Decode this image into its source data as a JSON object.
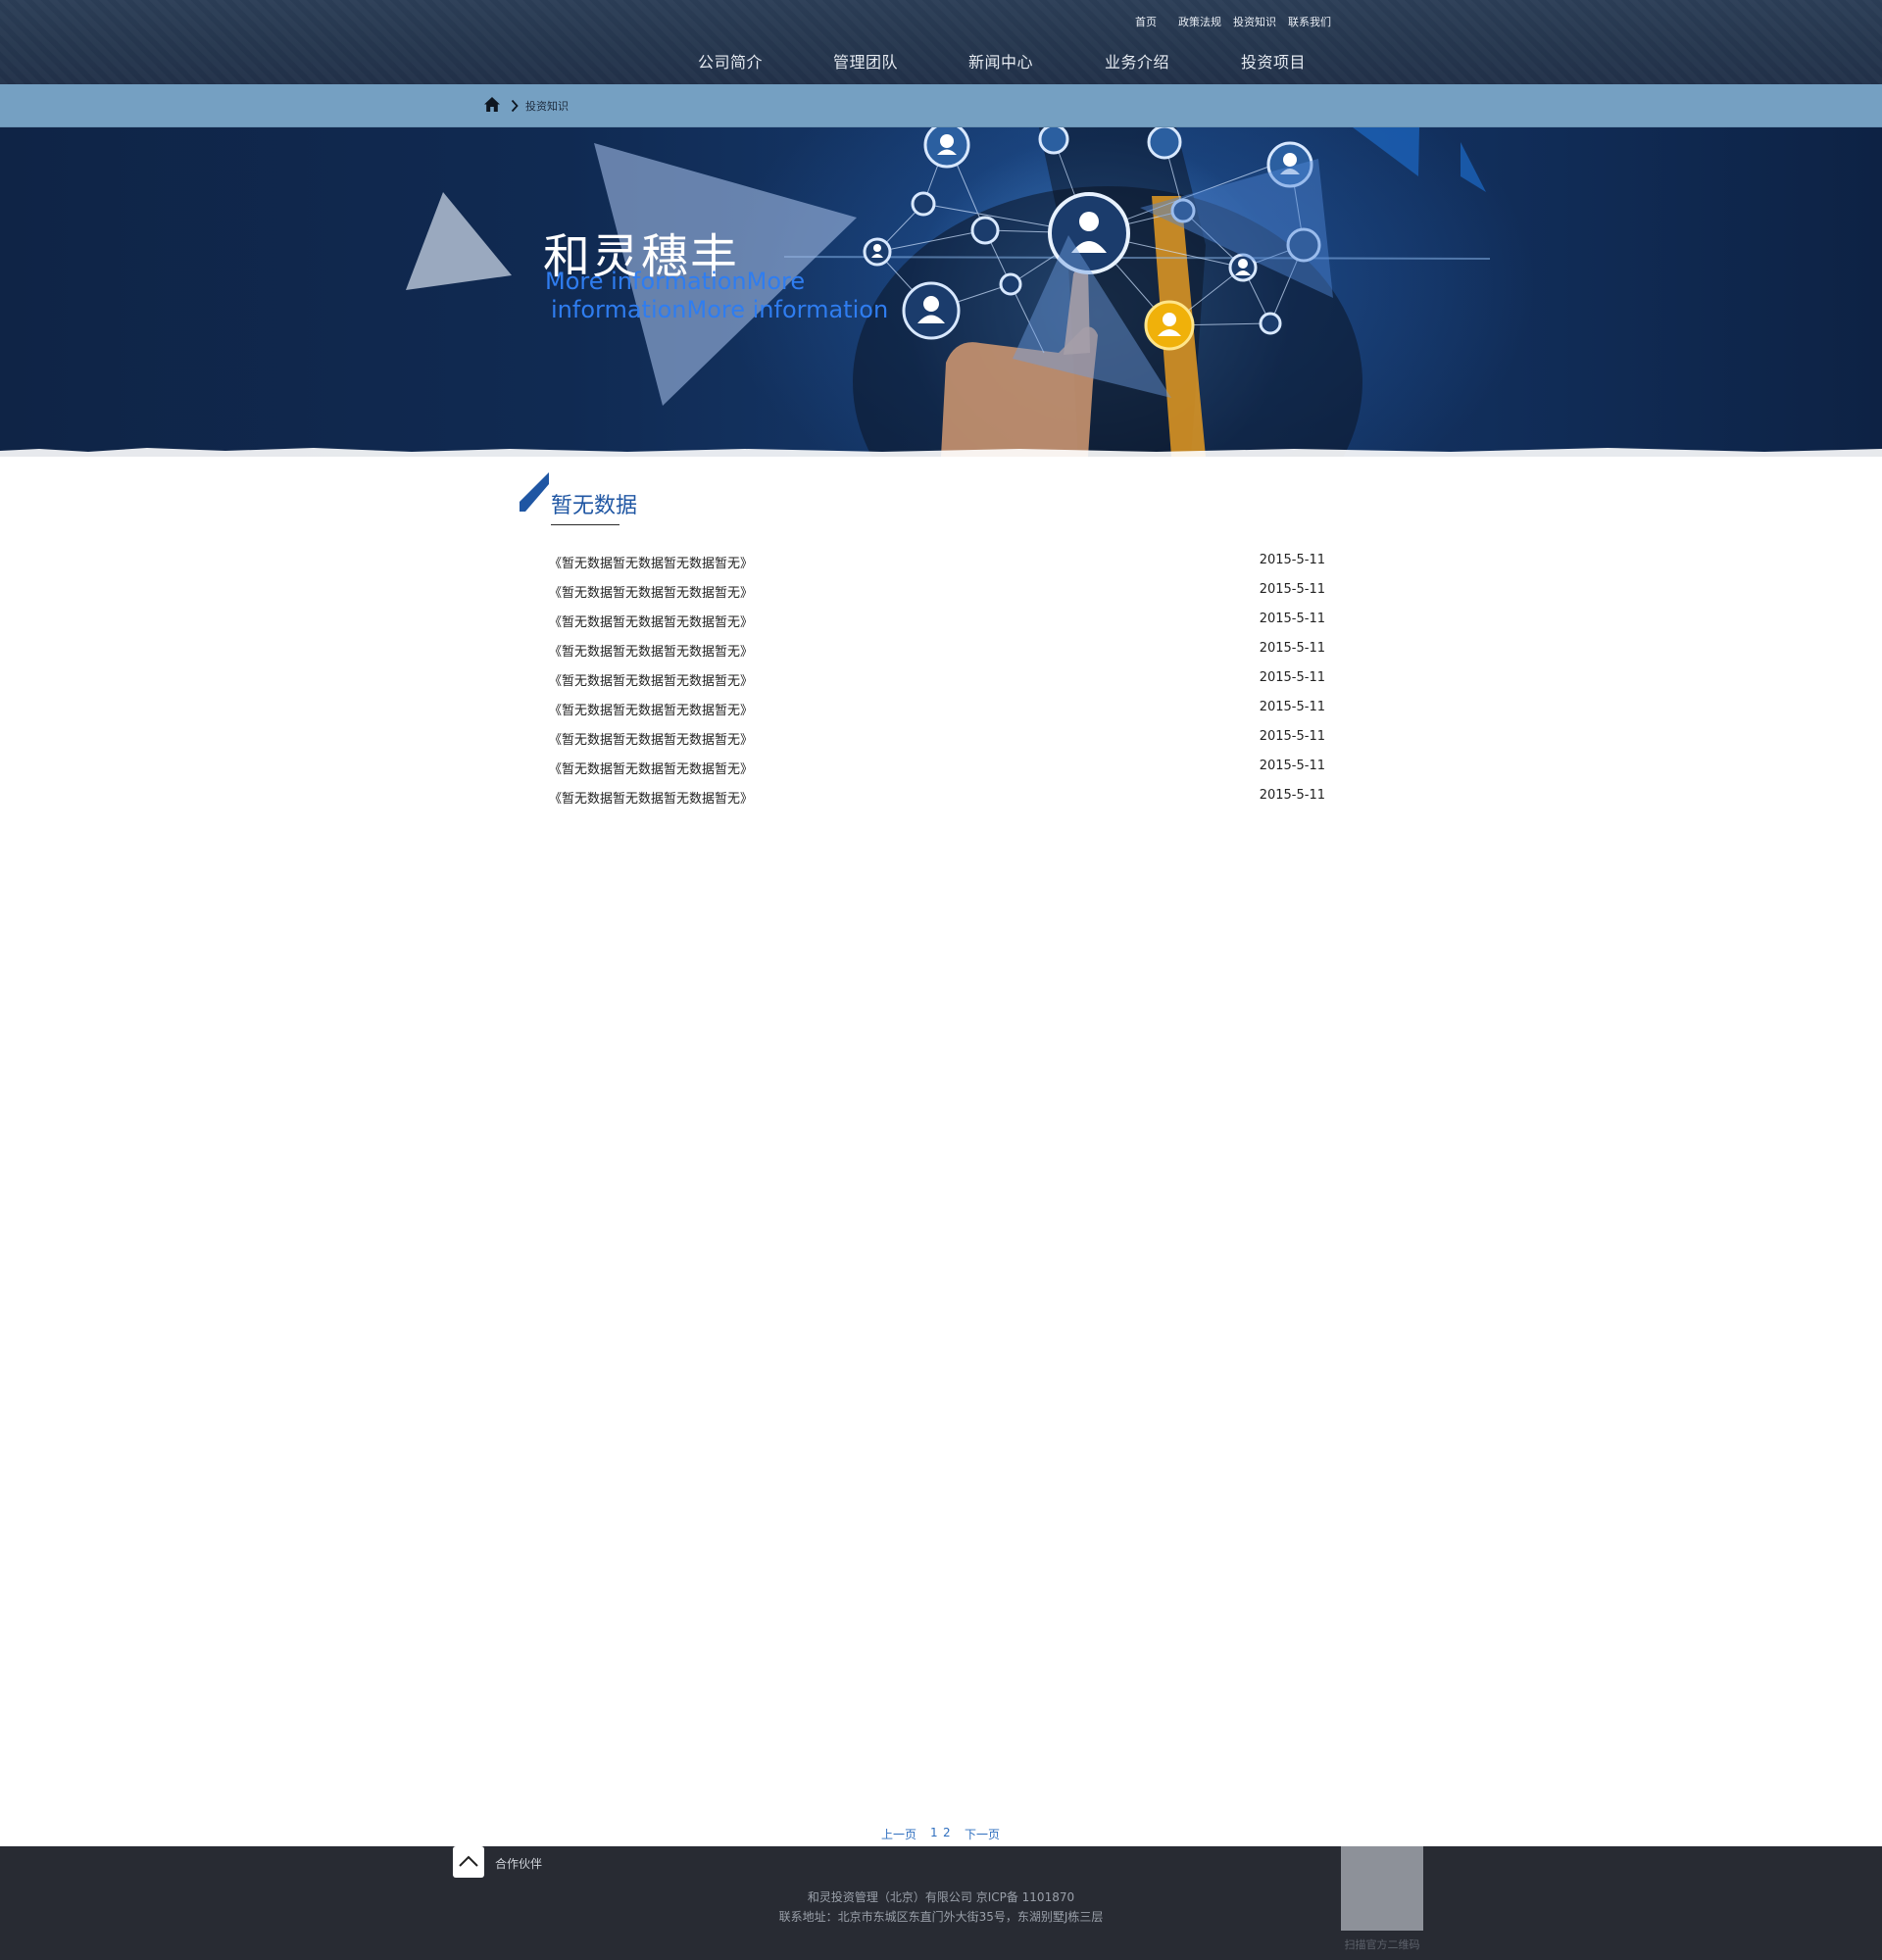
{
  "header": {
    "top_links": [
      "首页",
      "政策法规",
      "投资知识",
      "联系我们"
    ],
    "nav": [
      "公司简介",
      "管理团队",
      "新闻中心",
      "业务介绍",
      "投资项目"
    ]
  },
  "breadcrumb": {
    "home_icon": "home-icon",
    "separator_icon": "chevron-right-icon",
    "current": "投资知识"
  },
  "banner": {
    "title": "和灵穗丰",
    "subtitle_line1": "More informationMore",
    "subtitle_line2": "informationMore information"
  },
  "section": {
    "title": "暂无数据"
  },
  "articles": [
    {
      "title": "《暂无数据暂无数据暂无数据暂无》",
      "date": "2015-5-11"
    },
    {
      "title": "《暂无数据暂无数据暂无数据暂无》",
      "date": "2015-5-11"
    },
    {
      "title": "《暂无数据暂无数据暂无数据暂无》",
      "date": "2015-5-11"
    },
    {
      "title": "《暂无数据暂无数据暂无数据暂无》",
      "date": "2015-5-11"
    },
    {
      "title": "《暂无数据暂无数据暂无数据暂无》",
      "date": "2015-5-11"
    },
    {
      "title": "《暂无数据暂无数据暂无数据暂无》",
      "date": "2015-5-11"
    },
    {
      "title": "《暂无数据暂无数据暂无数据暂无》",
      "date": "2015-5-11"
    },
    {
      "title": "《暂无数据暂无数据暂无数据暂无》",
      "date": "2015-5-11"
    },
    {
      "title": "《暂无数据暂无数据暂无数据暂无》",
      "date": "2015-5-11"
    }
  ],
  "pagination": {
    "prev": "上一页",
    "pages": [
      "1",
      "2"
    ],
    "next": "下一页"
  },
  "footer": {
    "back_top_icon": "chevron-up-icon",
    "partners": "合作伙伴",
    "company_line": "和灵投资管理（北京）有限公司 京ICP备 1101870",
    "address_line": "联系地址：北京市东城区东直门外大街35号，东湖别墅J栋三层",
    "qr_label": "扫描官方二维码"
  },
  "colors": {
    "header_bg": "#26374f",
    "breadcrumb_bg": "#75a0c2",
    "accent_blue": "#1f56a3",
    "subtitle_blue": "#2f7df0",
    "footer_bg": "#282b33"
  }
}
